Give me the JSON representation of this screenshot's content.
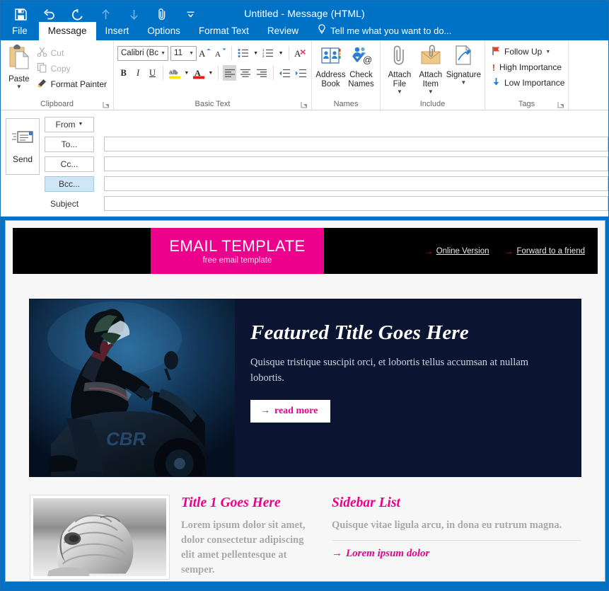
{
  "window": {
    "title": "Untitled - Message (HTML)",
    "quick_access": [
      {
        "name": "save-icon",
        "label": "Save",
        "enabled": true
      },
      {
        "name": "undo-icon",
        "label": "Undo",
        "enabled": true
      },
      {
        "name": "redo-icon",
        "label": "Redo",
        "enabled": true
      },
      {
        "name": "previous-item-icon",
        "label": "Previous Item",
        "enabled": false
      },
      {
        "name": "next-item-icon",
        "label": "Next Item",
        "enabled": false
      },
      {
        "name": "attach-file-icon",
        "label": "Attach File",
        "enabled": true
      },
      {
        "name": "customize-qat-icon",
        "label": "Customize Quick Access Toolbar",
        "enabled": true
      }
    ]
  },
  "ribbon": {
    "tabs": [
      {
        "label": "File",
        "active": false,
        "kind": "file"
      },
      {
        "label": "Message",
        "active": true
      },
      {
        "label": "Insert",
        "active": false
      },
      {
        "label": "Options",
        "active": false
      },
      {
        "label": "Format Text",
        "active": false
      },
      {
        "label": "Review",
        "active": false
      }
    ],
    "tell_me": "Tell me what you want to do...",
    "groups": {
      "clipboard": {
        "label": "Clipboard",
        "paste": {
          "label": "Paste"
        },
        "cut": {
          "label": "Cut",
          "disabled": true
        },
        "copy": {
          "label": "Copy",
          "disabled": true
        },
        "format_painter": {
          "label": "Format Painter",
          "disabled": false
        }
      },
      "basic_text": {
        "label": "Basic Text",
        "font_name": "Calibri (Bc",
        "font_size": "11",
        "buttons": {
          "grow_font": "A",
          "shrink_font": "A",
          "bullets": "Bullets",
          "numbering": "Numbering",
          "clear_formatting": "Clear All Formatting",
          "bold": "B",
          "italic": "I",
          "underline": "U",
          "highlight": "Text Highlight Color",
          "font_color": "A",
          "align_left": "Align Left",
          "align_center": "Center",
          "align_right": "Align Right",
          "decrease_indent": "Decrease Indent",
          "increase_indent": "Increase Indent"
        }
      },
      "names": {
        "label": "Names",
        "address_book": "Address Book",
        "check_names": "Check Names"
      },
      "include": {
        "label": "Include",
        "attach_file": "Attach File",
        "attach_item": "Attach Item",
        "signature": "Signature"
      },
      "tags": {
        "label": "Tags",
        "follow_up": "Follow Up",
        "high_importance": "High Importance",
        "low_importance": "Low Importance"
      }
    }
  },
  "compose": {
    "send_button": "Send",
    "from_button": "From",
    "to_button": "To...",
    "cc_button": "Cc...",
    "bcc_button": "Bcc...",
    "subject_label": "Subject",
    "to_value": "",
    "cc_value": "",
    "bcc_value": "",
    "subject_value": "",
    "to_placeholder": "",
    "cc_placeholder": "",
    "bcc_placeholder": "",
    "subject_placeholder": ""
  },
  "email": {
    "header": {
      "logo_title": "EMAIL TEMPLATE",
      "logo_subtitle": "free email template",
      "links": [
        {
          "label": "Online Version"
        },
        {
          "label": "Forward to a friend"
        }
      ]
    },
    "feature": {
      "image_alt": "motorcycle-rider-photo",
      "title": "Featured Title Goes Here",
      "body": "Quisque tristique suscipit orci, et lobortis tellus accumsan at nullam lobortis.",
      "cta": "read more"
    },
    "columns": {
      "left": {
        "image_alt": "seashell-photo",
        "title": "Title 1 Goes Here",
        "body": "Lorem ipsum dolor sit amet, dolor consectetur adipiscing elit amet pellentesque at semper."
      },
      "right": {
        "title": "Sidebar List",
        "intro": "Quisque vitae ligula arcu, in dona eu rutrum magna.",
        "items": [
          {
            "label": "Lorem ipsum dolor"
          }
        ]
      }
    }
  },
  "colors": {
    "accent_pink": "#EC008C",
    "window_blue": "#0072C6",
    "banner_black": "#000000",
    "feature_navy": "#0b1430",
    "bcc_highlight": "#cfe6f7"
  }
}
